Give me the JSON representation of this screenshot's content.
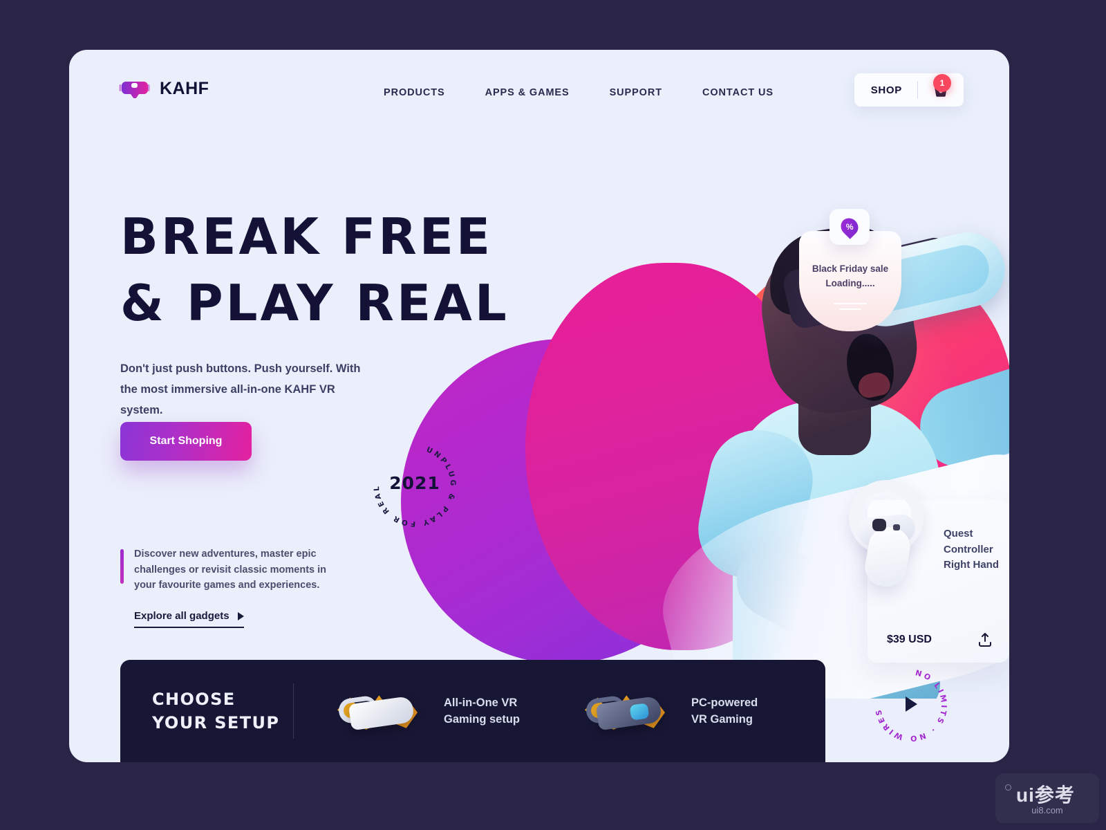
{
  "brand": {
    "name": "KAHF",
    "logo_icon": "vr-headset-icon",
    "accent_purple": "#8b35d6",
    "accent_pink": "#e4219f",
    "dark": "#131236"
  },
  "nav": {
    "items": [
      {
        "label": "PRODUCTS"
      },
      {
        "label": "APPS & GAMES"
      },
      {
        "label": "SUPPORT"
      },
      {
        "label": "CONTACT US"
      }
    ]
  },
  "shop": {
    "label": "SHOP",
    "cart_icon": "shopping-basket-icon",
    "cart_count": "1",
    "badge_color": "#f8475f"
  },
  "hero": {
    "headline_line1": "BREAK FREE",
    "headline_line2": "& PLAY REAL",
    "lede": "Don't just push buttons. Push yourself. With the most immersive all-in-one KAHF VR system.",
    "cta_label": "Start Shoping",
    "quote": "Discover new adventures, master epic challenges or revisit classic moments in your favourite games and experiences.",
    "explore_label": "Explore all gadgets",
    "explore_icon": "play-triangle-icon"
  },
  "year_badge": {
    "year": "2021",
    "ring_text": "UNPLUG & PLAY FOR REAL"
  },
  "promo": {
    "line1": "Black Friday sale",
    "line2": "Loading.....",
    "icon": "discount-flame-icon",
    "icon_glyph": "%"
  },
  "product": {
    "title": "Quest Controller Right Hand",
    "price": "$39 USD",
    "add_icon": "add-to-cart-upload-icon",
    "image_name": "vr-controller-image"
  },
  "setup": {
    "title_line1": "CHOOSE",
    "title_line2": "YOUR SETUP",
    "options": [
      {
        "label_line1": "All-in-One VR",
        "label_line2": "Gaming setup",
        "icon": "white-vr-headset-icon"
      },
      {
        "label_line1": "PC-powered",
        "label_line2": "VR Gaming",
        "icon": "dark-vr-headset-icon"
      }
    ]
  },
  "play_badge": {
    "ring_text": "NO LIMITS · NO WIRES ·",
    "icon": "play-triangle-icon"
  },
  "watermark": {
    "main": "ui参考",
    "sub": "ui8.com"
  }
}
